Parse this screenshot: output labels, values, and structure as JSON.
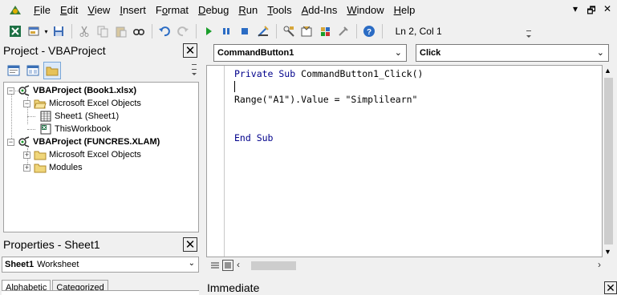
{
  "menu": {
    "items": [
      {
        "pre": "",
        "u": "F",
        "post": "ile"
      },
      {
        "pre": "",
        "u": "E",
        "post": "dit"
      },
      {
        "pre": "",
        "u": "V",
        "post": "iew"
      },
      {
        "pre": "",
        "u": "I",
        "post": "nsert"
      },
      {
        "pre": "F",
        "u": "o",
        "post": "rmat"
      },
      {
        "pre": "",
        "u": "D",
        "post": "ebug"
      },
      {
        "pre": "",
        "u": "R",
        "post": "un"
      },
      {
        "pre": "",
        "u": "T",
        "post": "ools"
      },
      {
        "pre": "",
        "u": "A",
        "post": "dd-Ins"
      },
      {
        "pre": "",
        "u": "W",
        "post": "indow"
      },
      {
        "pre": "",
        "u": "H",
        "post": "elp"
      }
    ],
    "window_controls": [
      "▾",
      "🗗",
      "✕"
    ]
  },
  "toolbar": {
    "status": "Ln 2, Col 1"
  },
  "project_pane": {
    "title": "Project - VBAProject",
    "close_glyph": "✕"
  },
  "project_tree": [
    {
      "label": "VBAProject (Book1.xlsx)",
      "bold": true
    },
    {
      "label": "Microsoft Excel Objects",
      "bold": false
    },
    {
      "label": "Sheet1 (Sheet1)",
      "bold": false
    },
    {
      "label": "ThisWorkbook",
      "bold": false
    },
    {
      "label": "VBAProject (FUNCRES.XLAM)",
      "bold": true
    },
    {
      "label": "Microsoft Excel Objects",
      "bold": false
    },
    {
      "label": "Modules",
      "bold": false
    }
  ],
  "properties_pane": {
    "title": "Properties - Sheet1",
    "close_glyph": "✕",
    "object_name": "Sheet1",
    "object_type": "Worksheet",
    "tabs": [
      "Alphabetic",
      "Categorized"
    ]
  },
  "code_window": {
    "object_combo": "CommandButton1",
    "procedure_combo": "Click",
    "lines": [
      {
        "kw": "Private Sub ",
        "text": "CommandButton1_Click()"
      },
      {
        "kw": "",
        "text": ""
      },
      {
        "kw": "",
        "text": "Range(\"A1\").Value = \"Simplilearn\""
      },
      {
        "kw": "",
        "text": ""
      },
      {
        "kw": "",
        "text": ""
      },
      {
        "kw": "End Sub",
        "text": ""
      }
    ]
  },
  "immediate": {
    "title": "Immediate",
    "close_glyph": "✕"
  },
  "icons": {
    "app": "vba-editor-icon",
    "excel": "excel-icon",
    "insert_userform": "insert-userform-icon",
    "save": "save-icon",
    "cut": "cut-icon",
    "copy": "copy-icon",
    "paste": "paste-icon",
    "find": "find-icon",
    "undo": "undo-icon",
    "redo": "redo-icon",
    "run": "run-icon",
    "break": "break-icon",
    "reset": "reset-icon",
    "design_mode": "design-mode-icon",
    "project_explorer": "project-explorer-icon",
    "properties_window": "properties-window-icon",
    "object_browser": "object-browser-icon",
    "toolbox": "toolbox-icon",
    "help": "help-icon"
  },
  "colors": {
    "keyword": "#00008b",
    "background": "#f0f0f0",
    "run_green": "#1a9e2b",
    "help_blue": "#2b6cc4"
  }
}
